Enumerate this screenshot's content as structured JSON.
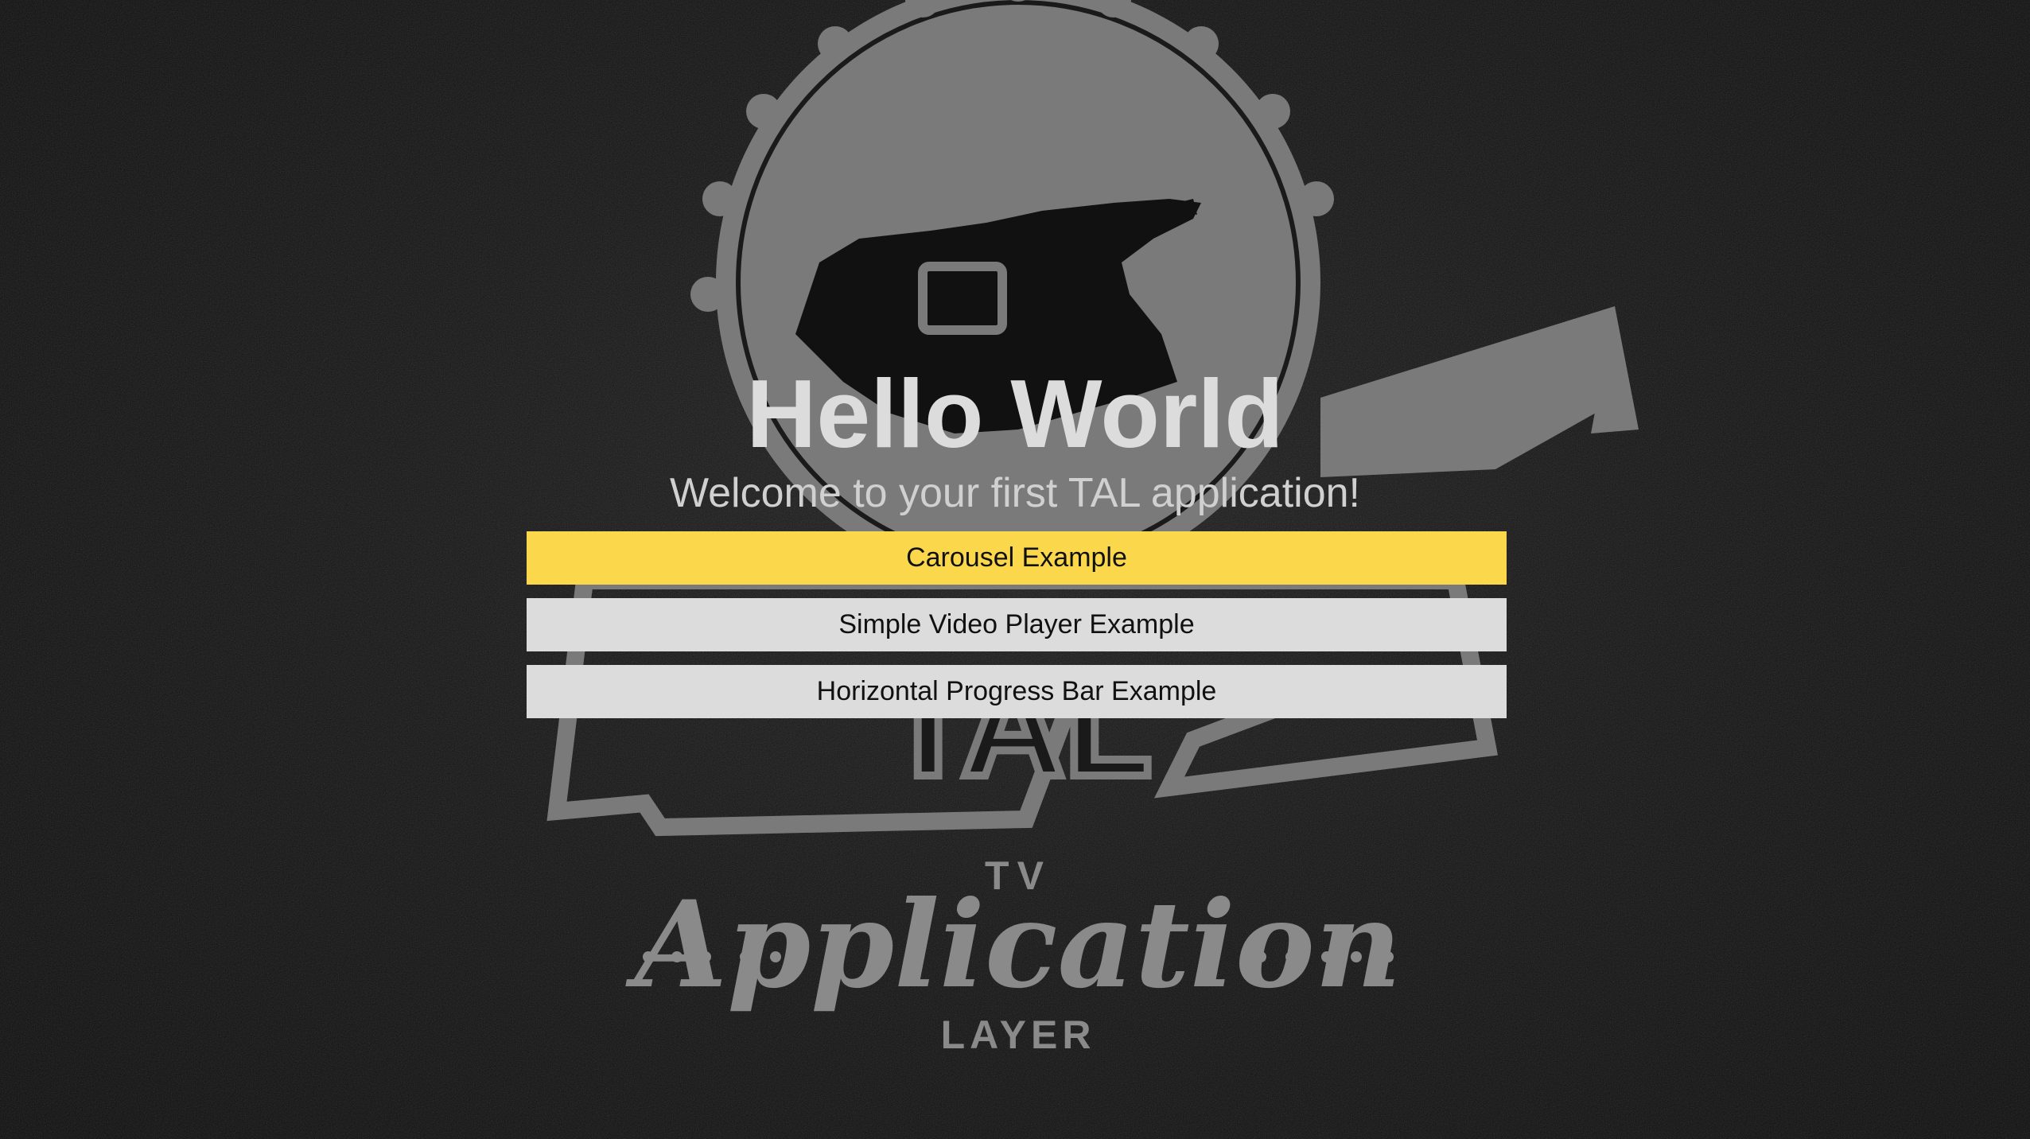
{
  "app": {
    "title": "Hello World",
    "subtitle": "Welcome to your first TAL application!"
  },
  "menu": {
    "items": [
      {
        "label": "Carousel Example",
        "focused": true
      },
      {
        "label": "Simple Video Player Example",
        "focused": false
      },
      {
        "label": "Horizontal Progress Bar Example",
        "focused": false
      }
    ]
  },
  "background_logo": {
    "icon": "tal-logo-badge",
    "badge_text": "TAL",
    "top_text": "TV",
    "script_text": "Application",
    "bottom_text": "LAYER"
  },
  "colors": {
    "background": "#0c0c0c",
    "logo": "#7d7d7d",
    "focus": "#fbd74b",
    "button": "#dcdcdc",
    "text_light": "#dcdcdc"
  }
}
